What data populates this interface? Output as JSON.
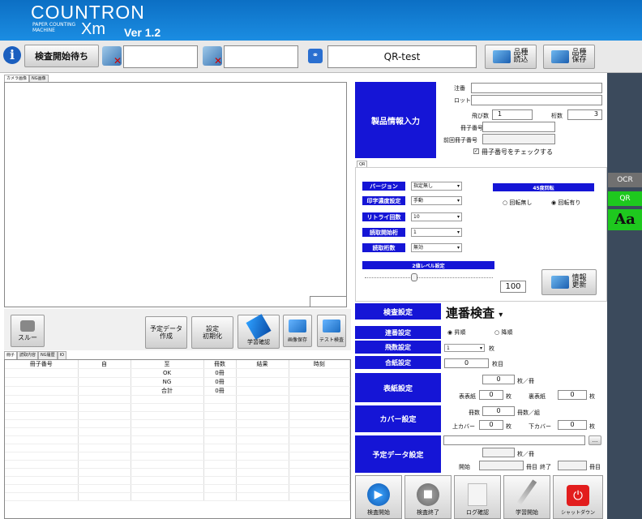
{
  "brand": {
    "name": "COUNTRON",
    "sub1": "PAPER COUNTING",
    "sub2": "MACHINE",
    "model": "Xm",
    "version": "Ver 1.2"
  },
  "toolbar": {
    "status": "検査開始待ち",
    "field1": "",
    "field2": "",
    "qr_title": "QR-test",
    "load_btn": "品種\n読込",
    "save_btn": "品種\n保存"
  },
  "camera_tabs": [
    "カメラ画像",
    "NG画像"
  ],
  "product": {
    "header": "製品情報入力",
    "order_label": "注番",
    "order": "",
    "lot_label": "ロット",
    "lot": "",
    "skip_label": "飛び数",
    "skip": "1",
    "digits_label": "桁数",
    "digits": "3",
    "booklet_no_label": "冊子番号",
    "booklet_no": "",
    "prev_booklet_label": "前回冊子番号",
    "prev_booklet": "",
    "check_label": "冊子番号をチェックする"
  },
  "qr_tab": "QR",
  "qr": {
    "version_label": "バージョン",
    "version_val": "指定無し",
    "density_label": "印字濃度設定",
    "density_val": "手動",
    "retry_label": "リトライ回数",
    "retry_val": "10",
    "read_start_label": "読取開始桁",
    "read_start_val": "1",
    "read_digits_label": "読取桁数",
    "read_digits_val": "無効",
    "rot_header": "45度回転",
    "rot_off": "回転無し",
    "rot_on": "回転有り",
    "bin_header": "2値レベル設定",
    "bin_value": "100",
    "info_update": "情報\n更新"
  },
  "side": {
    "ocr": "OCR",
    "qr": "QR",
    "font": "Aa"
  },
  "left_buttons": {
    "slue": "スルー",
    "plan_create": "予定データ\n作成",
    "settings_reset": "設定\n初期化",
    "learn_confirm": "学習確認",
    "image_save": "画像保存",
    "test_inspect": "テスト検査"
  },
  "list_tabs": [
    "冊子",
    "読取内容",
    "NG履歴",
    "IO"
  ],
  "table": {
    "headers": [
      "冊子番号",
      "自",
      "至",
      "冊数",
      "結果",
      "時刻"
    ],
    "rows": [
      [
        "",
        "",
        "OK",
        "0冊",
        "",
        ""
      ],
      [
        "",
        "",
        "NG",
        "0冊",
        "",
        ""
      ],
      [
        "",
        "",
        "合計",
        "0冊",
        "",
        ""
      ]
    ]
  },
  "insp": {
    "setting_label": "検査設定",
    "mode": "連番検査",
    "seq_label": "連番設定",
    "asc": "昇順",
    "desc": "降順",
    "skip_label": "飛数設定",
    "skip_val": "1",
    "skip_unit": "枚",
    "sheet_label": "合紙設定",
    "sheet_val": "0",
    "sheet_unit": "枚目",
    "cover_label": "表紙設定",
    "cover_val": "0",
    "cover_unit": "枚／冊",
    "front_label": "表表紙",
    "front_val": "0",
    "front_unit": "枚",
    "back_label": "裏表紙",
    "back_val": "0",
    "back_unit": "枚",
    "kaba_label": "カバー設定",
    "kaba_count_label": "冊数",
    "kaba_count": "0",
    "kaba_count_unit": "冊数／組",
    "upper_label": "上カバー",
    "upper_val": "0",
    "upper_unit": "枚",
    "lower_label": "下カバー",
    "lower_val": "0",
    "lower_unit": "枚",
    "plan_label": "予定データ設定",
    "plan_path": "",
    "plan_browse": "...",
    "plan_unit": "枚／冊",
    "start_label": "開始",
    "start_unit": "冊目",
    "end_label": "終了",
    "end_unit": "冊目"
  },
  "bottom": {
    "start": "検査開始",
    "stop": "検査終了",
    "log": "ログ確認",
    "learn": "学習開始",
    "shutdown": "シャットダウン"
  }
}
